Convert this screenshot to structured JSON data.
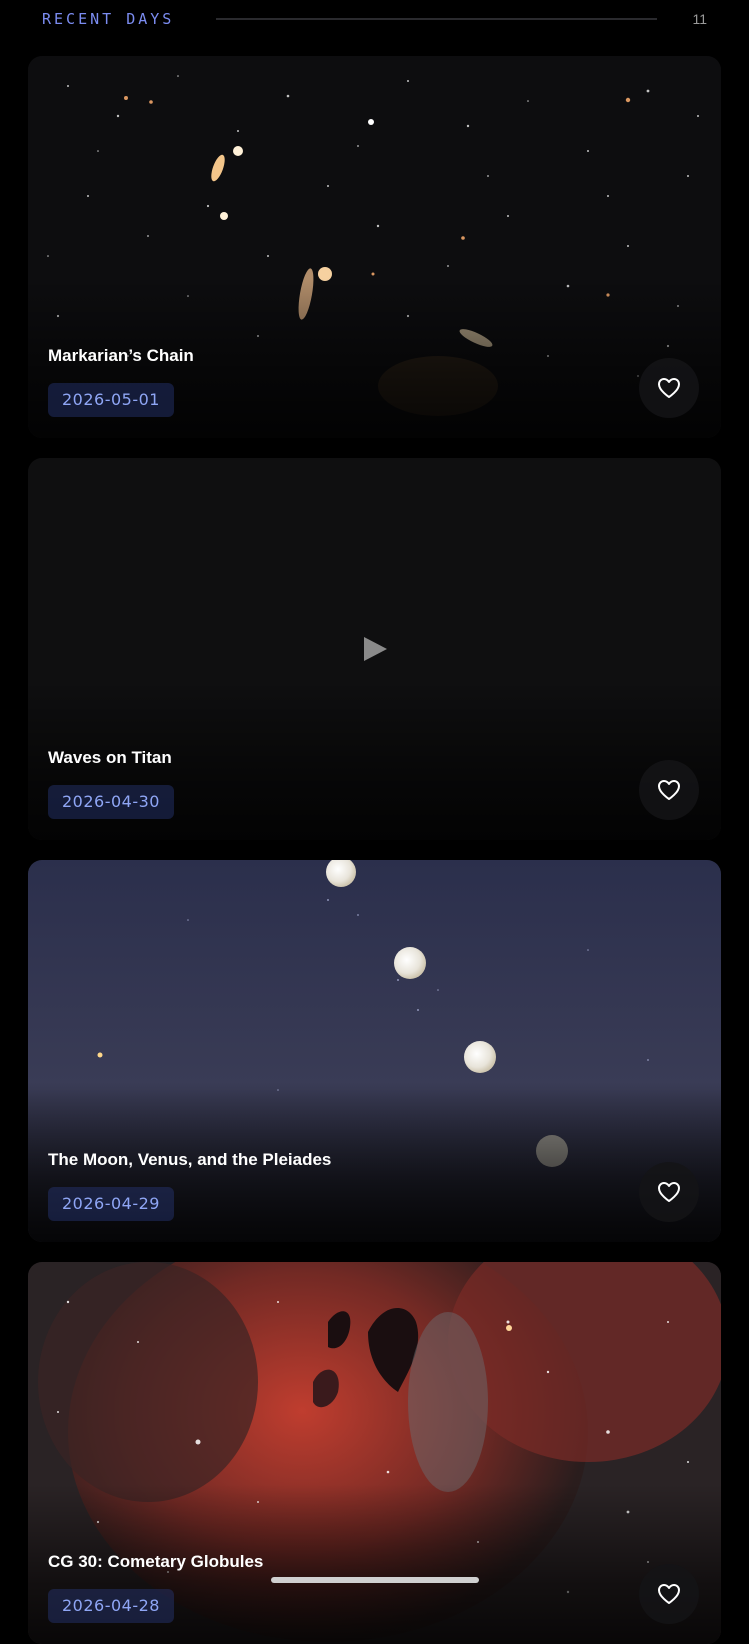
{
  "section": {
    "title": "RECENT DAYS",
    "count": "11"
  },
  "cards": [
    {
      "title": "Markarian’s Chain",
      "date": "2026-05-01",
      "media": "image",
      "favorite_icon": "heart-outline-icon"
    },
    {
      "title": "Waves on Titan",
      "date": "2026-04-30",
      "media": "video",
      "favorite_icon": "heart-outline-icon",
      "play_icon": "play-icon"
    },
    {
      "title": "The Moon, Venus, and the Pleiades",
      "date": "2026-04-29",
      "media": "image",
      "favorite_icon": "heart-outline-icon"
    },
    {
      "title": "CG 30: Cometary Globules",
      "date": "2026-04-28",
      "media": "image",
      "favorite_icon": "heart-outline-icon"
    }
  ],
  "colors": {
    "accent": "#7b8cf0",
    "date_text": "#8fa6f5",
    "background": "#000000"
  }
}
